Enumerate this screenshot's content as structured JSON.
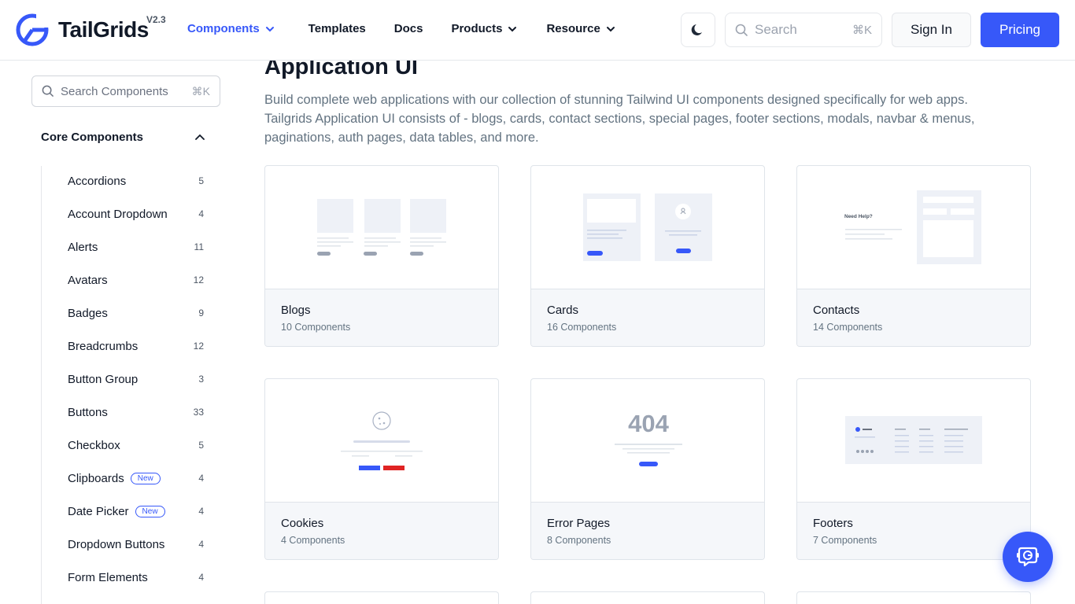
{
  "header": {
    "logo_text": "TailGrids",
    "version": "V2.3",
    "nav": [
      {
        "label": "Components"
      },
      {
        "label": "Templates"
      },
      {
        "label": "Docs"
      },
      {
        "label": "Products"
      },
      {
        "label": "Resource"
      }
    ],
    "search_placeholder": "Search",
    "search_shortcut": "⌘K",
    "signin_label": "Sign In",
    "pricing_label": "Pricing"
  },
  "sidebar": {
    "search_placeholder": "Search Components",
    "search_shortcut": "⌘K",
    "group_title": "Core Components",
    "items": [
      {
        "label": "Accordions",
        "count": "5"
      },
      {
        "label": "Account Dropdown",
        "count": "4"
      },
      {
        "label": "Alerts",
        "count": "11"
      },
      {
        "label": "Avatars",
        "count": "12"
      },
      {
        "label": "Badges",
        "count": "9"
      },
      {
        "label": "Breadcrumbs",
        "count": "12"
      },
      {
        "label": "Button Group",
        "count": "3"
      },
      {
        "label": "Buttons",
        "count": "33"
      },
      {
        "label": "Checkbox",
        "count": "5"
      },
      {
        "label": "Clipboards",
        "count": "4",
        "badge": "New"
      },
      {
        "label": "Date Picker",
        "count": "4",
        "badge": "New"
      },
      {
        "label": "Dropdown Buttons",
        "count": "4"
      },
      {
        "label": "Form Elements",
        "count": "4"
      }
    ]
  },
  "main": {
    "title": "Application UI",
    "description": "Build complete web applications with our collection of stunning Tailwind UI components designed specifically for web apps. Tailgrids Application UI consists of - blogs, cards, contact sections, special pages, footer sections, modals, navbar & menus, paginations, auth pages, data tables, and more.",
    "cards": [
      {
        "title": "Blogs",
        "subtitle": "10 Components"
      },
      {
        "title": "Cards",
        "subtitle": "16 Components"
      },
      {
        "title": "Contacts",
        "subtitle": "14 Components",
        "thumb_text": "Need Help?"
      },
      {
        "title": "Cookies",
        "subtitle": "4 Components"
      },
      {
        "title": "Error Pages",
        "subtitle": "8 Components",
        "thumb_text": "404"
      },
      {
        "title": "Footers",
        "subtitle": "7 Components"
      }
    ]
  },
  "colors": {
    "primary": "#3758f9",
    "text": "#111928",
    "muted": "#637381",
    "border": "#dfe4ea"
  }
}
